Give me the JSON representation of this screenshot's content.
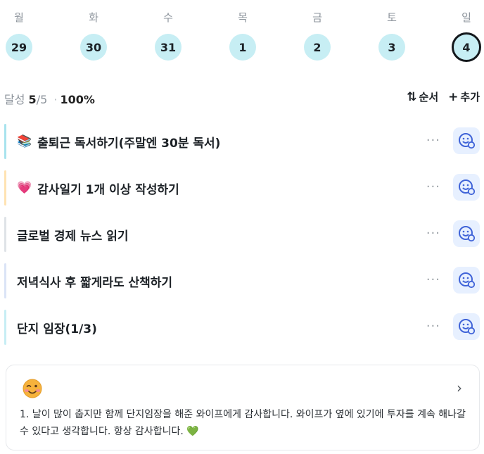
{
  "week": [
    {
      "label": "월",
      "date": "29"
    },
    {
      "label": "화",
      "date": "30"
    },
    {
      "label": "수",
      "date": "31"
    },
    {
      "label": "목",
      "date": "1"
    },
    {
      "label": "금",
      "date": "2"
    },
    {
      "label": "토",
      "date": "3"
    },
    {
      "label": "일",
      "date": "4",
      "selected": true
    }
  ],
  "summary": {
    "label": "달성",
    "done": "5",
    "total_sep": "/5",
    "dot": "·",
    "percent": "100%"
  },
  "actions": {
    "order_glyph": "⇅",
    "order_label": "순서",
    "add_glyph": "+",
    "add_label": "추가"
  },
  "tasks": [
    {
      "emoji": "📚",
      "title": "출퇴근 독서하기(주말엔 30분 독서)",
      "bar_color": "#a8e3ee",
      "more": "···"
    },
    {
      "emoji": "💗",
      "title": "감사일기 1개 이상 작성하기",
      "bar_color": "#ffe3b3",
      "more": "···"
    },
    {
      "emoji": "",
      "title": "글로벌 경제 뉴스 읽기",
      "bar_color": "#dfe3e7",
      "more": "···"
    },
    {
      "emoji": "",
      "title": "저녁식사 후 짧게라도 산책하기",
      "bar_color": "#dbe4f6",
      "more": "···"
    },
    {
      "emoji": "",
      "title": "단지 임장(1/3)",
      "bar_color": "#c7eef4",
      "more": "···"
    }
  ],
  "diary": {
    "icon": "smiling-face-icon",
    "chevron": "›",
    "text": "1. 날이 많이 춥지만 함께 단지임장을 해준 와이프에게 감사합니다. 와이프가 옆에 있기에 투자를 계속 해나갈 수 있다고 생각합니다. 항상 감사합니다.",
    "heart": "💚"
  }
}
